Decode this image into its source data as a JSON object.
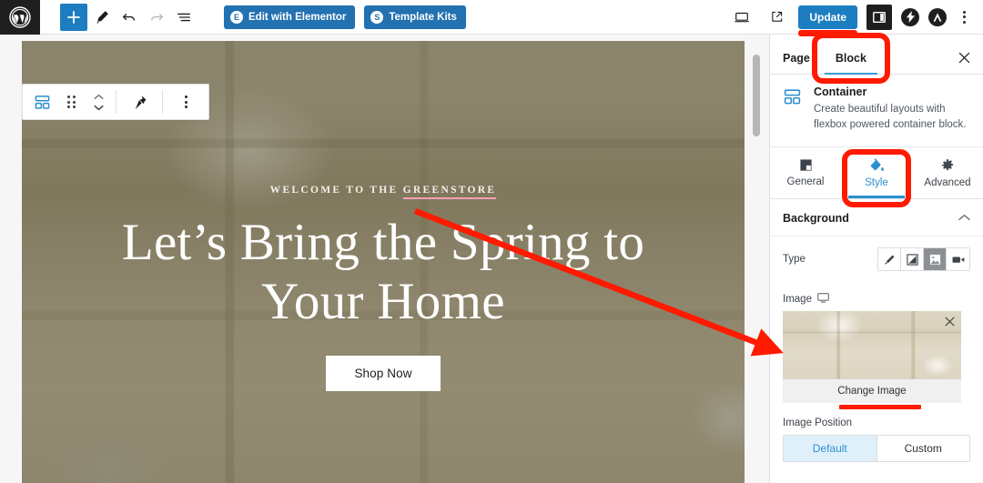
{
  "topbar": {
    "logo_icon": "wordpress-logo-icon",
    "add_block_label": "+",
    "tools": [
      {
        "name": "add-block-button",
        "icon": "plus-icon"
      },
      {
        "name": "edit-tool-button",
        "icon": "pencil-icon"
      },
      {
        "name": "undo-button",
        "icon": "undo-arrow-icon"
      },
      {
        "name": "redo-button",
        "icon": "redo-arrow-icon"
      },
      {
        "name": "document-overview-button",
        "icon": "list-view-icon"
      }
    ],
    "elementor_button": "Edit with Elementor",
    "elementor_badge": "E",
    "template_kits_button": "Template Kits",
    "template_kits_badge": "S",
    "preview_icon": "desktop-preview-icon",
    "view_site_icon": "external-link-icon",
    "update_label": "Update",
    "settings_icon": "sidebar-panel-icon",
    "jetpack_icon": "lightning-bolt-icon",
    "astra_icon": "astra-logo-icon",
    "options_icon": "kebab-menu-icon"
  },
  "block_toolbar": {
    "container_icon": "container-block-icon",
    "drag_icon": "drag-handle-icon",
    "move_up_icon": "chevron-up-icon",
    "move_down_icon": "chevron-down-icon",
    "pin_icon": "pushpin-icon",
    "more_icon": "kebab-menu-icon"
  },
  "hero": {
    "eyebrow_prefix": "WELCOME TO THE ",
    "eyebrow_highlight": "GREENSTORE",
    "title": "Let’s Bring the Spring to Your Home",
    "cta_label": "Shop Now",
    "overlay_color": "#484226",
    "highlight_color": "#f5a0b5"
  },
  "sidebar": {
    "tabs": [
      {
        "label": "Page",
        "active": false
      },
      {
        "label": "Block",
        "active": true
      }
    ],
    "close_icon": "close-icon",
    "block": {
      "icon": "container-block-icon",
      "name": "Container",
      "description": "Create beautiful layouts with flexbox powered container block."
    },
    "segments": [
      {
        "label": "General",
        "icon": "general-square-icon",
        "active": false
      },
      {
        "label": "Style",
        "icon": "paint-bucket-icon",
        "active": true
      },
      {
        "label": "Advanced",
        "icon": "gear-icon",
        "active": false
      }
    ],
    "background": {
      "section_title": "Background",
      "collapse_icon": "chevron-up-icon",
      "type_label": "Type",
      "type_options": [
        {
          "name": "classic",
          "icon": "brush-icon",
          "active": false
        },
        {
          "name": "gradient",
          "icon": "gradient-icon",
          "active": false
        },
        {
          "name": "image",
          "icon": "image-icon",
          "active": true
        },
        {
          "name": "video",
          "icon": "video-camera-icon",
          "active": false
        }
      ],
      "image_label": "Image",
      "image_device_icon": "desktop-icon",
      "image_remove_icon": "close-icon",
      "change_image_label": "Change Image",
      "image_position_label": "Image Position",
      "image_position_options": [
        {
          "label": "Default",
          "active": true
        },
        {
          "label": "Custom",
          "active": false
        }
      ]
    }
  },
  "annotations": {
    "color": "#ff1a00",
    "items": [
      {
        "name": "block-tab-highlight",
        "type": "box"
      },
      {
        "name": "style-tab-highlight",
        "type": "box"
      },
      {
        "name": "change-image-underline",
        "type": "underline"
      },
      {
        "name": "update-button-underline",
        "type": "underline"
      },
      {
        "name": "pointer-arrow",
        "type": "arrow"
      }
    ]
  }
}
